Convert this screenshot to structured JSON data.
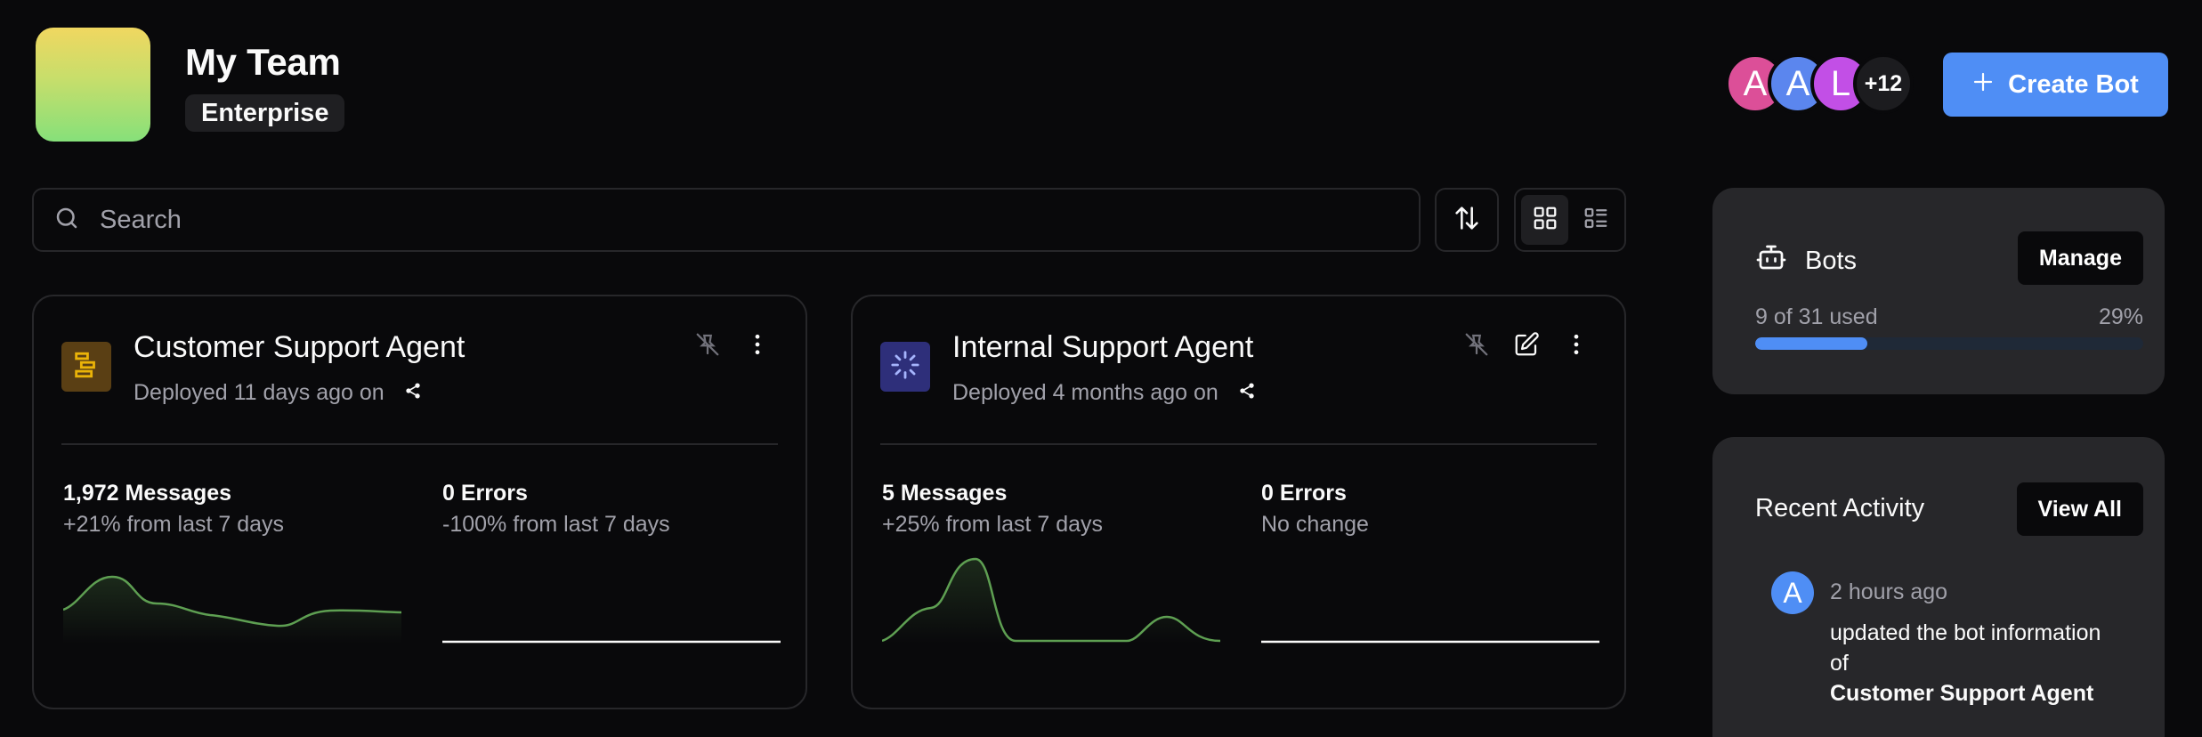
{
  "team": {
    "name": "My Team",
    "plan": "Enterprise"
  },
  "members": {
    "avatars": [
      {
        "initial": "A",
        "color": "#dc4f98"
      },
      {
        "initial": "A",
        "color": "#5b86ee"
      },
      {
        "initial": "L",
        "color": "#c24fe6"
      }
    ],
    "more": "+12"
  },
  "create_button": {
    "label": "Create Bot",
    "icon": "plus-icon"
  },
  "search": {
    "placeholder": "Search",
    "value": ""
  },
  "bots": [
    {
      "name": "Customer Support Agent",
      "deployed": "Deployed 11 days ago on",
      "icon": "gantt-icon",
      "icon_color": "#eab308",
      "icon_bg": "#5a3f14",
      "messages": "1,972 Messages",
      "messages_delta": "+21% from last 7 days",
      "errors": "0 Errors",
      "errors_delta": "-100% from last 7 days"
    },
    {
      "name": "Internal Support Agent",
      "deployed": "Deployed 4 months ago on",
      "icon": "loader-icon",
      "icon_color": "#a5b4fc",
      "icon_bg": "#2e2f7a",
      "messages": "5 Messages",
      "messages_delta": "+25% from last 7 days",
      "errors": "0 Errors",
      "errors_delta": "No change"
    }
  ],
  "bots_panel": {
    "title": "Bots",
    "manage": "Manage",
    "usage_text": "9 of 31 used",
    "usage_percent_label": "29%",
    "usage_fraction": 0.29
  },
  "activity_panel": {
    "title": "Recent Activity",
    "view_all": "View All",
    "items": [
      {
        "initial": "A",
        "time": "2 hours ago",
        "text": "updated the bot information of",
        "target": "Customer Support Agent"
      }
    ]
  },
  "colors": {
    "accent": "#4f8ef5",
    "background": "#09090b",
    "panel": "#27272a",
    "spark": "#5e9f52"
  }
}
